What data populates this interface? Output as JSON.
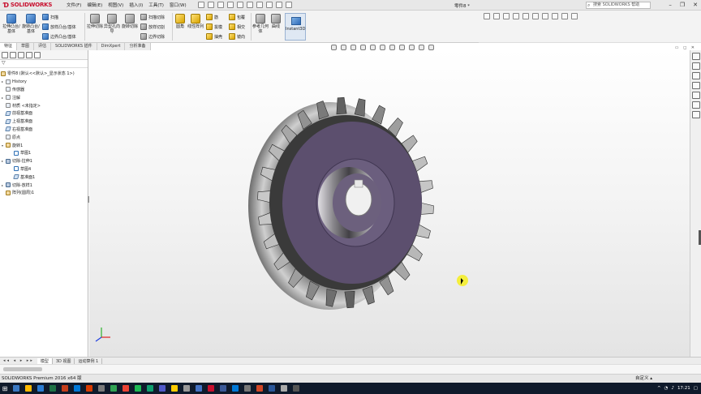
{
  "app": {
    "brand": "SOLIDWORKS",
    "doc_title": "零件8 *",
    "search_placeholder": "搜索 SOLIDWORKS 帮助"
  },
  "menu": [
    "文件(F)",
    "编辑(E)",
    "视图(V)",
    "插入(I)",
    "工具(T)",
    "窗口(W)"
  ],
  "commands": {
    "extrude_boss": "拉伸凸台/基体",
    "revolve_boss": "旋转凸台/基体",
    "sweep": "扫描",
    "loft_boss": "放样凸台/基体",
    "boundary_boss": "边界凸台/基体",
    "extrude_cut": "拉伸切除",
    "hole_wizard": "异型孔向导",
    "revolve_cut": "旋转切除",
    "swept_cut": "扫描切除",
    "lofted_cut": "放样切割",
    "boundary_cut": "边界切除",
    "fillet": "圆角",
    "linear_pattern": "线性阵列",
    "rib": "筋",
    "draft": "拔模",
    "shell": "抽壳",
    "wrap": "包覆",
    "intersect": "相交",
    "mirror": "镜向",
    "ref_geometry": "参考几何体",
    "curves": "曲线",
    "instant3d": "Instant3D"
  },
  "tabs": [
    "特征",
    "草图",
    "评估",
    "SOLIDWORKS 插件",
    "DimXpert",
    "分析准备"
  ],
  "tree": {
    "root": "零件8 (默认<<默认>_显示状态 1>)",
    "items": [
      {
        "label": "History",
        "type": "folder",
        "exp": "▸"
      },
      {
        "label": "传感器",
        "type": "folder",
        "exp": ""
      },
      {
        "label": "注解",
        "type": "folder",
        "exp": "▸"
      },
      {
        "label": "材质 <未指定>",
        "type": "folder",
        "exp": ""
      },
      {
        "label": "前视基准面",
        "type": "plane",
        "exp": ""
      },
      {
        "label": "上视基准面",
        "type": "plane",
        "exp": ""
      },
      {
        "label": "右视基准面",
        "type": "plane",
        "exp": ""
      },
      {
        "label": "原点",
        "type": "origin",
        "exp": ""
      },
      {
        "label": "旋转1",
        "type": "feat",
        "exp": "▾"
      },
      {
        "label": "草图1",
        "type": "sk",
        "exp": ""
      },
      {
        "label": "切除-拉伸1",
        "type": "cut",
        "exp": "▸"
      },
      {
        "label": "草图4",
        "type": "sk",
        "exp": ""
      },
      {
        "label": "基准面1",
        "type": "plane",
        "exp": ""
      },
      {
        "label": "切除-放样1",
        "type": "cut",
        "exp": "▸"
      },
      {
        "label": "阵列(圆周)1",
        "type": "feat",
        "exp": ""
      }
    ]
  },
  "bottom_tabs": [
    "模型",
    "3D 视图",
    "运动算例 1"
  ],
  "status": {
    "left": "SOLIDWORKS Premium 2016 x64 版",
    "right": "自定义 ▴"
  },
  "taskbar": {
    "time": "17:21"
  }
}
